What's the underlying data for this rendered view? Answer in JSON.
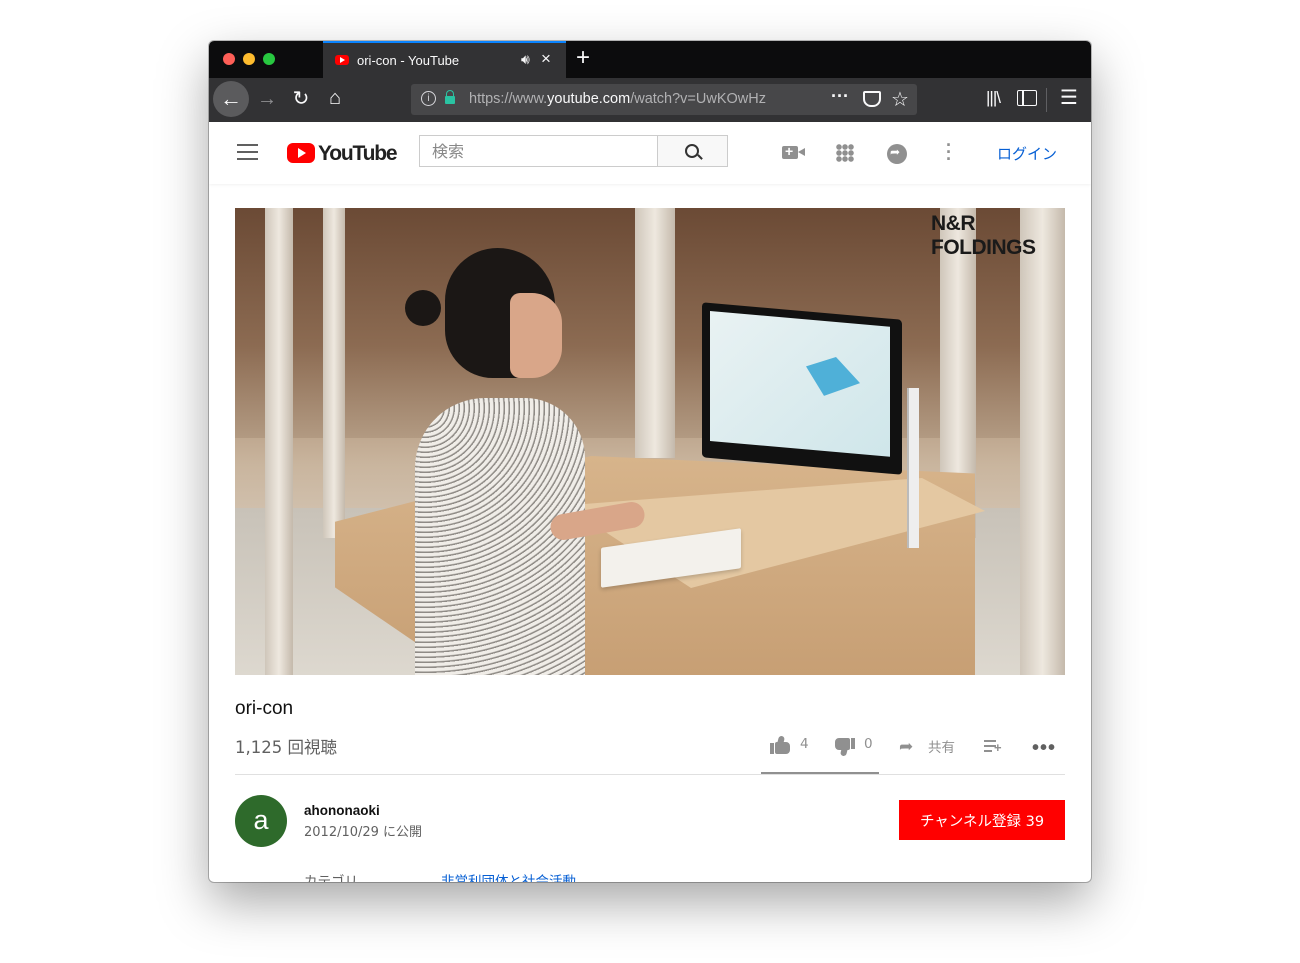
{
  "browser": {
    "tab_title": "ori-con - YouTube",
    "new_tab_symbol": "+",
    "url_prefix": "https://www.",
    "url_domain": "youtube.com",
    "url_path": "/watch?v=UwKOwHz",
    "audio_icon": "speaker-icon",
    "accent_color": "#0a84ff"
  },
  "youtube": {
    "logo_text": "YouTube",
    "search_placeholder": "検索",
    "login_label": "ログイン",
    "brand_color": "#ff0000",
    "link_color": "#065fd4"
  },
  "video": {
    "watermark": "N&R\nFOLDINGS",
    "title": "ori-con",
    "views": "1,125 回視聴",
    "likes": "4",
    "dislikes": "0",
    "share_label": "共有",
    "like_ratio": 1.0
  },
  "channel": {
    "avatar_letter": "a",
    "name": "ahononaoki",
    "published": "2012/10/29 に公開",
    "subscribe_label": "チャンネル登録  39",
    "category_label": "カテゴリ",
    "category_value": "非営利団体と社会活動"
  }
}
